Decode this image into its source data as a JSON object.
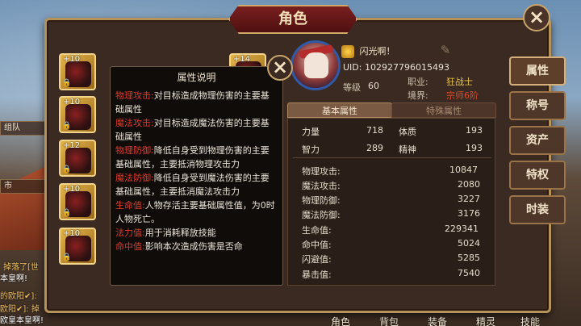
{
  "window": {
    "title": "角色",
    "close_icon": "close-icon"
  },
  "hud": {
    "top_values": [
      "",
      "",
      ""
    ]
  },
  "equipment_left": [
    {
      "level": "+10",
      "locked": true
    },
    {
      "level": "+10",
      "locked": true
    },
    {
      "level": "+12",
      "locked": true
    },
    {
      "level": "+10",
      "locked": true
    },
    {
      "level": "+10",
      "locked": true
    }
  ],
  "equipment_right_top": {
    "level": "+14"
  },
  "profile": {
    "name": "闪光啊！",
    "uid": "UID: 102927796015493",
    "level_label": "等级",
    "level": "60",
    "job_label": "职业:",
    "job": "狂战士",
    "realm_label": "境界:",
    "realm": "宗师6阶"
  },
  "tabs": [
    {
      "label": "基本属性",
      "active": true
    },
    {
      "label": "特殊属性",
      "active": false
    }
  ],
  "base_stats": [
    {
      "name": "力量",
      "value": "718"
    },
    {
      "name": "体质",
      "value": "193"
    },
    {
      "name": "智力",
      "value": "289"
    },
    {
      "name": "精神",
      "value": "193"
    }
  ],
  "combat_stats": [
    {
      "name": "物理攻击:",
      "value": "10847"
    },
    {
      "name": "魔法攻击:",
      "value": "2080"
    },
    {
      "name": "物理防御:",
      "value": "3227"
    },
    {
      "name": "魔法防御:",
      "value": "3176"
    },
    {
      "name": "生命值:",
      "value": "229341"
    },
    {
      "name": "命中值:",
      "value": "5024"
    },
    {
      "name": "闪避值:",
      "value": "5285"
    },
    {
      "name": "暴击值:",
      "value": "7540"
    }
  ],
  "side_tabs": [
    {
      "label": "属性",
      "active": true
    },
    {
      "label": "称号",
      "active": false
    },
    {
      "label": "资产",
      "active": false
    },
    {
      "label": "特权",
      "active": false
    },
    {
      "label": "时装",
      "active": false
    }
  ],
  "popup": {
    "title": "属性说明",
    "entries": [
      {
        "key": "物理攻击:",
        "text": "对目标造成物理伤害的主要基础属性"
      },
      {
        "key": "魔法攻击:",
        "text": "对目标造成魔法伤害的主要基础属性"
      },
      {
        "key": "物理防御:",
        "text": "降低自身受到物理伤害的主要基础属性，主要抵消物理攻击力"
      },
      {
        "key": "魔法防御:",
        "text": "降低自身受到魔法伤害的主要基础属性，主要抵消魔法攻击力"
      },
      {
        "key": "生命值:",
        "text": "人物存活主要基础属性值，为0时人物死亡。"
      },
      {
        "key": "法力值:",
        "text": "用于消耗释放技能"
      },
      {
        "key": "命中值:",
        "text": "影响本次造成伤害是否命"
      }
    ]
  },
  "bottom_nav": [
    "角色",
    "背包",
    "装备",
    "精灵",
    "技能"
  ],
  "left_side": {
    "btn1": "组队",
    "btn2": "市",
    "chat1": "掉落了[世",
    "chat2": "本皇啊!",
    "chat3": "的欧阳✔]: ",
    "chat4": "欧阳✔]: 掉",
    "chat5": "欧皇本皇啊!"
  }
}
